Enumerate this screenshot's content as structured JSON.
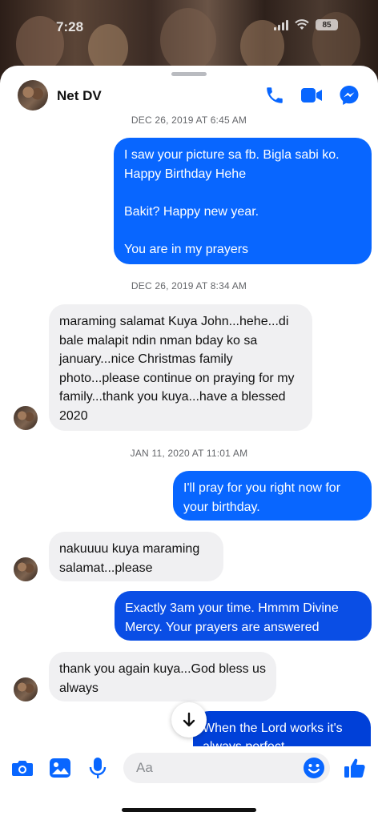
{
  "status": {
    "time": "7:28",
    "battery": "85"
  },
  "header": {
    "contact_name": "Net DV"
  },
  "thread": {
    "timestamps": [
      "DEC 26, 2019 AT 6:45 AM",
      "DEC 26, 2019 AT 8:34 AM",
      "JAN 11, 2020 AT 11:01 AM"
    ],
    "messages": [
      {
        "from": "me",
        "text": "I saw your picture sa fb. Bigla sabi ko. Happy Birthday Hehe\n\nBakit? Happy new year.\n\nYou are in my prayers"
      },
      {
        "from": "contact",
        "text": "maraming salamat Kuya John...hehe...di bale malapit ndin nman bday ko sa january...nice Christmas family photo...please continue on praying for my family...thank you kuya...have a blessed 2020"
      },
      {
        "from": "me",
        "text": "I'll pray for you right now for your birthday."
      },
      {
        "from": "contact",
        "text": "nakuuuu kuya maraming salamat...please"
      },
      {
        "from": "me",
        "text": "Exactly 3am your time. Hmmm Divine Mercy. Your prayers are answered"
      },
      {
        "from": "contact",
        "text": "thank you again kuya...God bless us always"
      },
      {
        "from": "me",
        "text": "When the Lord works it's always perfect"
      }
    ]
  },
  "composer": {
    "placeholder": "Aa"
  },
  "colors": {
    "accent": "#0866ff",
    "bubble_in": "#f0f0f2",
    "timestamp": "#65676b"
  },
  "icons": [
    "phone-icon",
    "video-icon",
    "messenger-icon",
    "camera-icon",
    "gallery-icon",
    "microphone-icon",
    "emoji-icon",
    "like-icon",
    "arrow-down-icon"
  ]
}
